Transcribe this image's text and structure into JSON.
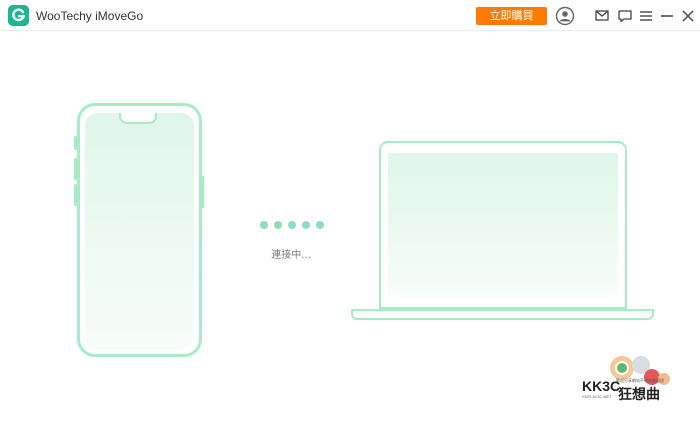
{
  "app": {
    "title": "WooTechy iMoveGo",
    "brand_color": "#1fb58f"
  },
  "toolbar": {
    "buy_label": "立即購買",
    "buy_color": "#ff7a00",
    "icons": [
      "account-icon",
      "mail-icon",
      "feedback-icon",
      "menu-icon",
      "minimize-icon",
      "close-icon"
    ]
  },
  "main": {
    "status_text": "連接中...",
    "source_device": "phone",
    "target_device": "laptop",
    "device_outline_color": "#a6ecc7",
    "dot_color": "#8fdcb6",
    "dot_count": 5
  },
  "watermark": {
    "brand": "KK3C",
    "name": "狂想曲",
    "tagline": "歡迎分享網站不做商業用途",
    "url": "KKPLAY3C.NET"
  }
}
